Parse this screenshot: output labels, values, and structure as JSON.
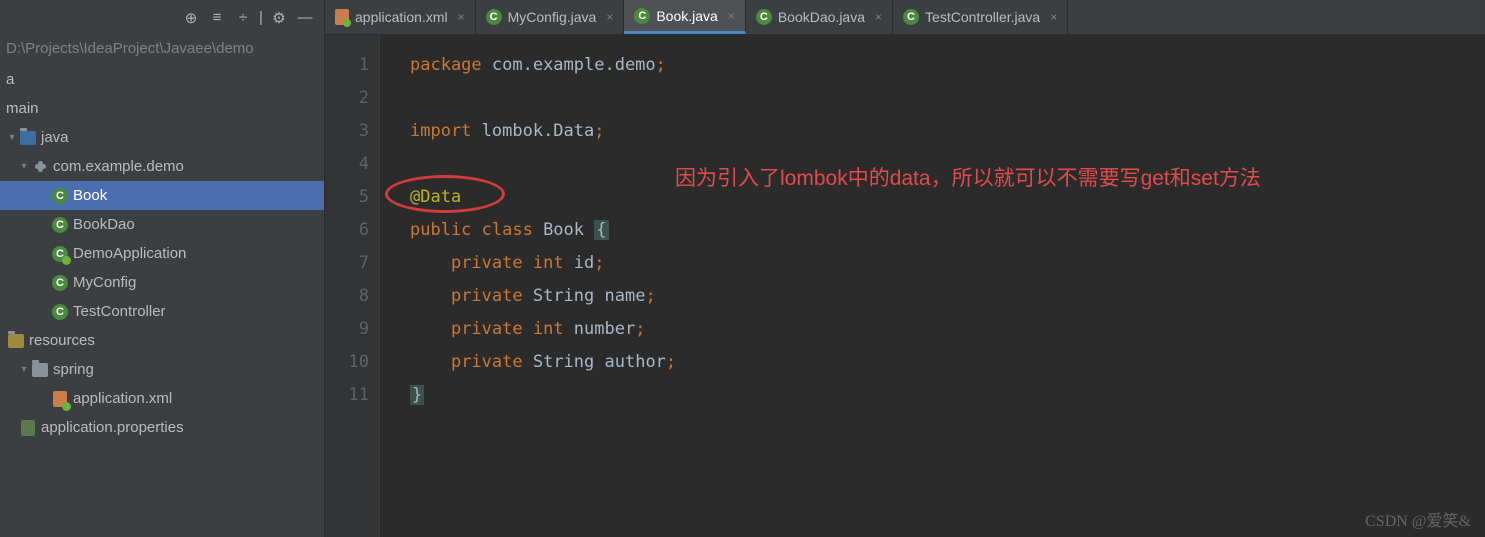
{
  "breadcrumb": "D:\\Projects\\IdeaProject\\Javaee\\demo",
  "tree": {
    "trunc": "a",
    "main": "main",
    "java": "java",
    "pkg": "com.example.demo",
    "items": [
      "Book",
      "BookDao",
      "DemoApplication",
      "MyConfig",
      "TestController"
    ],
    "resources": "resources",
    "spring": "spring",
    "appxml": "application.xml",
    "appprops": "application.properties"
  },
  "tabs": [
    {
      "label": "application.xml",
      "type": "xml"
    },
    {
      "label": "MyConfig.java",
      "type": "java"
    },
    {
      "label": "Book.java",
      "type": "java",
      "active": true
    },
    {
      "label": "BookDao.java",
      "type": "java"
    },
    {
      "label": "TestController.java",
      "type": "java"
    }
  ],
  "gutter": [
    "1",
    "2",
    "3",
    "4",
    "5",
    "6",
    "7",
    "8",
    "9",
    "10",
    "11"
  ],
  "code": {
    "l1": {
      "kw": "package ",
      "pkg": "com.example.demo",
      "smc": ";"
    },
    "l3": {
      "kw": "import ",
      "pkg": "lombok.Data",
      "smc": ";"
    },
    "l5": {
      "anno": "@Data"
    },
    "l6": {
      "kw": "public class ",
      "cls": "Book ",
      "br": "{"
    },
    "l7": {
      "in": "    ",
      "kw": "private ",
      "typ": "int ",
      "fld": "id",
      "smc": ";"
    },
    "l8": {
      "in": "    ",
      "kw": "private ",
      "typ": "String ",
      "fld": "name",
      "smc": ";"
    },
    "l9": {
      "in": "    ",
      "kw": "private ",
      "typ": "int ",
      "fld": "number",
      "smc": ";"
    },
    "l10": {
      "in": "    ",
      "kw": "private ",
      "typ": "String ",
      "fld": "author",
      "smc": ";"
    },
    "l11": {
      "br": "}"
    }
  },
  "annotation": "因为引入了lombok中的data，所以就可以不需要写get和set方法",
  "watermark": "CSDN @爱笑&"
}
